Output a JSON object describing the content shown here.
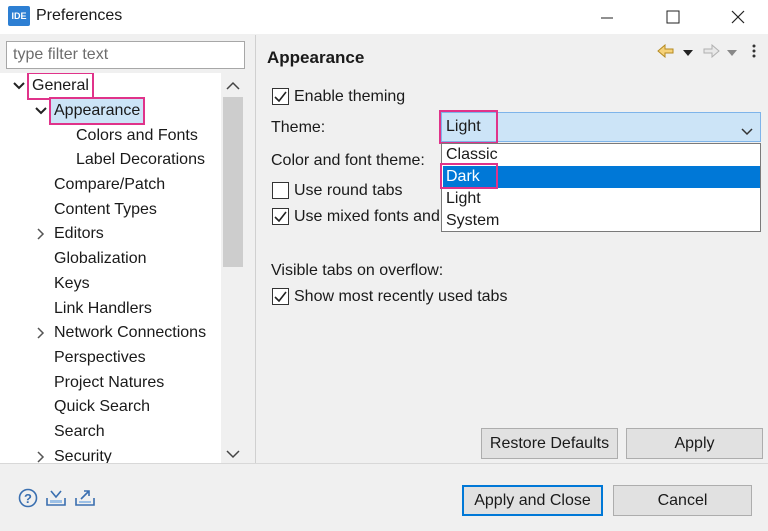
{
  "window": {
    "title": "Preferences",
    "app_icon_text": "IDE"
  },
  "filter": {
    "placeholder": "type filter text"
  },
  "tree": {
    "items": [
      {
        "label": "General"
      },
      {
        "label": "Appearance"
      },
      {
        "label": "Colors and Fonts"
      },
      {
        "label": "Label Decorations"
      },
      {
        "label": "Compare/Patch"
      },
      {
        "label": "Content Types"
      },
      {
        "label": "Editors"
      },
      {
        "label": "Globalization"
      },
      {
        "label": "Keys"
      },
      {
        "label": "Link Handlers"
      },
      {
        "label": "Network Connections"
      },
      {
        "label": "Perspectives"
      },
      {
        "label": "Project Natures"
      },
      {
        "label": "Quick Search"
      },
      {
        "label": "Search"
      },
      {
        "label": "Security"
      }
    ]
  },
  "page": {
    "title": "Appearance",
    "enable_theming": "Enable theming",
    "theme_label": "Theme:",
    "theme_value": "Light",
    "theme_options": [
      "Classic",
      "Dark",
      "Light",
      "System"
    ],
    "color_font_theme_label": "Color and font theme:",
    "use_round_tabs": "Use round tabs",
    "use_mixed_fonts": "Use mixed fonts and",
    "visible_tabs_label": "Visible tabs on overflow:",
    "show_recent_tabs": "Show most recently used tabs",
    "restore_defaults": "Restore Defaults",
    "apply": "Apply"
  },
  "footer": {
    "apply_close": "Apply and Close",
    "cancel": "Cancel"
  },
  "colors": {
    "highlight": "#e0338a",
    "selection": "#0078d7"
  }
}
